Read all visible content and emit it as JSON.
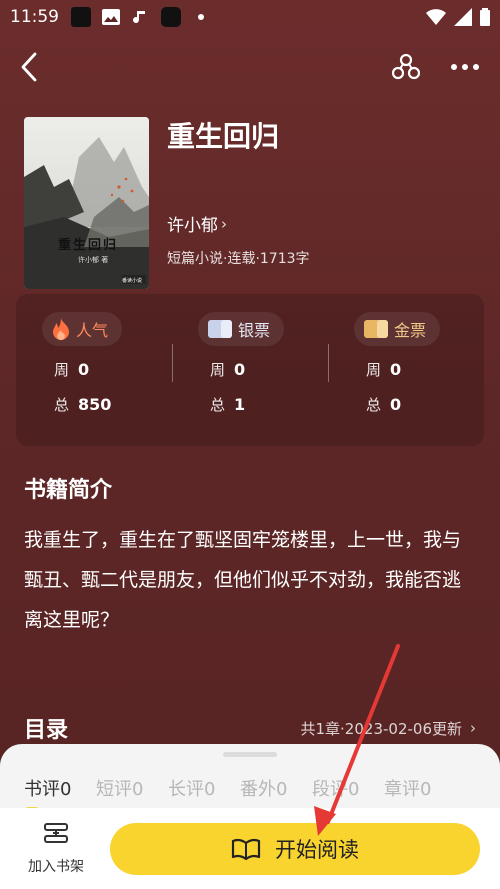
{
  "status": {
    "time": "11:59"
  },
  "book": {
    "title": "重生回归",
    "author": "许小郁",
    "meta": "短篇小说·连载·1713字",
    "cover": {
      "title": "重生回归",
      "author": "许小郁 著",
      "publisher": "番读小说"
    }
  },
  "stats": [
    {
      "label": "人气",
      "week_label": "周",
      "week": "0",
      "total_label": "总",
      "total": "850"
    },
    {
      "label": "银票",
      "week_label": "周",
      "week": "0",
      "total_label": "总",
      "total": "1"
    },
    {
      "label": "金票",
      "week_label": "周",
      "week": "0",
      "total_label": "总",
      "total": "0"
    }
  ],
  "intro": {
    "title": "书籍简介",
    "text": "我重生了，重生在了甄坚固牢笼楼里，上一世，我与甄丑、甄二代是朋友，但他们似乎不对劲，我能否逃离这里呢？"
  },
  "toc": {
    "title": "目录",
    "meta": "共1章·2023-02-06更新"
  },
  "tabs": [
    "书评0",
    "短评0",
    "长评0",
    "番外0",
    "段评0",
    "章评0"
  ],
  "bottom": {
    "shelf_label": "加入书架",
    "read_label": "开始阅读"
  },
  "colors": {
    "background": "#5e2727",
    "accent": "#f9d42f",
    "annotation": "#e53935"
  }
}
